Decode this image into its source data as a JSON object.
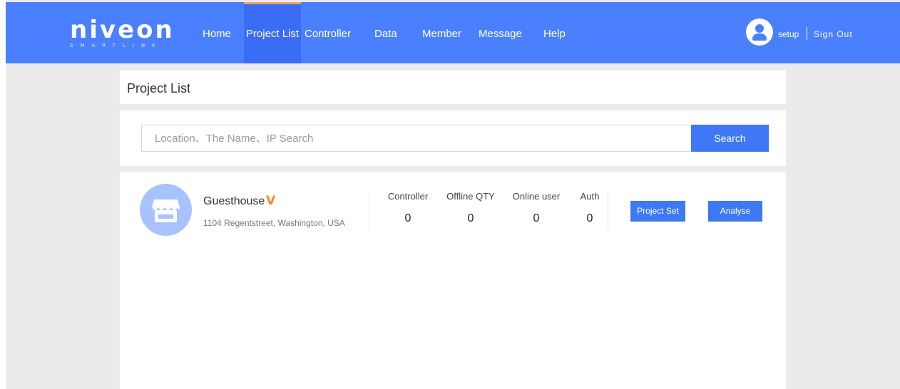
{
  "brand": {
    "logo_text": "niveon",
    "logo_subtext": "SMARTLINK"
  },
  "nav": {
    "items": [
      {
        "label": "Home"
      },
      {
        "label": "Project List"
      },
      {
        "label": "Controller"
      },
      {
        "label": "Data"
      },
      {
        "label": "Member"
      },
      {
        "label": "Message"
      },
      {
        "label": "Help"
      }
    ],
    "active": "Project List"
  },
  "user": {
    "name": "setup",
    "sign_out": "Sign Out"
  },
  "page": {
    "title": "Project List"
  },
  "search": {
    "placeholder": "Location、The Name、IP Search",
    "value": "",
    "button": "Search"
  },
  "project": {
    "name": "Guesthouse",
    "badge": "V",
    "address": "1104 Regentstreet, Washington, USA",
    "stats": [
      {
        "label": "Controller",
        "value": "0"
      },
      {
        "label": "Offline QTY",
        "value": "0"
      },
      {
        "label": "Online user",
        "value": "0"
      },
      {
        "label": "Auth",
        "value": "0"
      }
    ],
    "buttons": {
      "project_set": "Project Set",
      "analyse": "Analyse"
    }
  },
  "colors": {
    "header_bg": "#4a80ff",
    "active_tab_bg": "#3a6cf5",
    "active_tab_indicator": "#f4a35a",
    "button": "#3f78f4",
    "vip_badge": "#f08a1f",
    "project_avatar": "#a8c2ff",
    "page_bg": "#ebebeb"
  }
}
